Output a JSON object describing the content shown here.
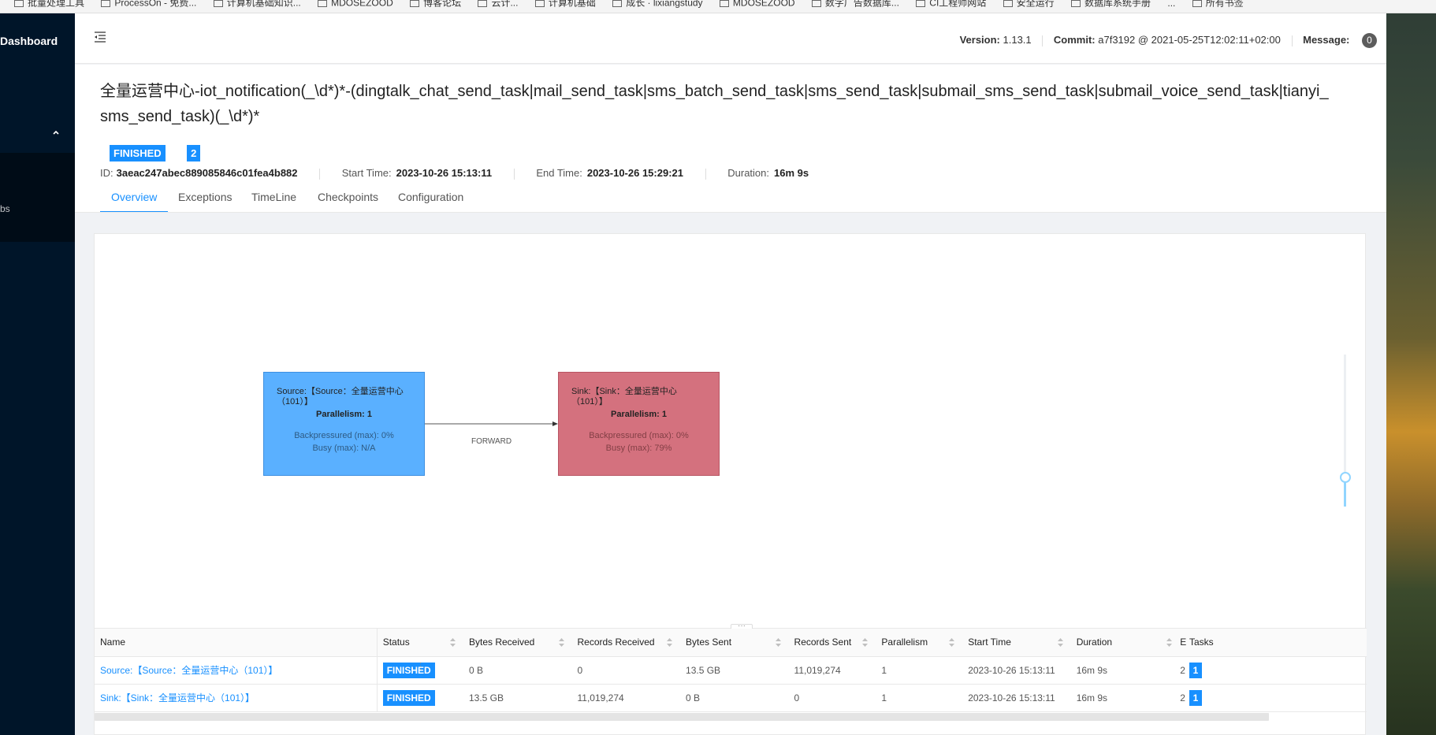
{
  "browser": {
    "bookmarks": [
      "批量处理工具",
      "ProcessOn - 免费...",
      "计算机基础知识...",
      "",
      "MDOSEZOOD",
      "博客论坛",
      "云计...",
      "计算机基础",
      "成长 · lixiangstudy",
      "MDOSEZOOD",
      "",
      "数字广告数据库...",
      "CI工程师网站",
      "安全运行",
      "数据库系统手册",
      "...",
      "所有书签"
    ]
  },
  "sidebar": {
    "brand": "Dashboard",
    "sub_item": "bs"
  },
  "topbar": {
    "version_label": "Version:",
    "version_value": "1.13.1",
    "commit_label": "Commit:",
    "commit_value": "a7f3192 @ 2021-05-25T12:02:11+02:00",
    "message_label": "Message:",
    "message_count": "0"
  },
  "job": {
    "title": "全量运营中心-iot_notification(_\\d*)*-(dingtalk_chat_send_task|mail_send_task|sms_batch_send_task|sms_send_task|submail_sms_send_task|submail_voice_send_task|tianyi_sms_send_task)(_\\d*)*",
    "status": "FINISHED",
    "task_count": "2",
    "id_label": "ID:",
    "id_value": "3aeac247abec889085846c01fea4b882",
    "start_label": "Start Time:",
    "start_value": "2023-10-26 15:13:11",
    "end_label": "End Time:",
    "end_value": "2023-10-26 15:29:21",
    "duration_label": "Duration:",
    "duration_value": "16m 9s"
  },
  "tabs": [
    {
      "label": "Overview"
    },
    {
      "label": "Exceptions"
    },
    {
      "label": "TimeLine"
    },
    {
      "label": "Checkpoints"
    },
    {
      "label": "Configuration"
    }
  ],
  "graph": {
    "source": {
      "name": "Source:【Source：全量运营中心（101）】",
      "parallelism": "Parallelism: 1",
      "backpressured": "Backpressured (max): 0%",
      "busy": "Busy (max): N/A"
    },
    "sink": {
      "name": "Sink:【Sink：全量运营中心（101）】",
      "parallelism": "Parallelism: 1",
      "backpressured": "Backpressured (max): 0%",
      "busy": "Busy (max): 79%"
    },
    "edge_label": "FORWARD",
    "colors": {
      "source": "#5ab0ff",
      "sink": "#d4717e",
      "accent": "#1890ff"
    }
  },
  "table": {
    "columns": [
      "Name",
      "Status",
      "Bytes Received",
      "Records Received",
      "Bytes Sent",
      "Records Sent",
      "Parallelism",
      "Start Time",
      "Duration",
      "E",
      "Tasks"
    ],
    "rows": [
      {
        "name": "Source:【Source：全量运营中心（101）】",
        "status": "FINISHED",
        "bytes_received": "0 B",
        "records_received": "0",
        "bytes_sent": "13.5 GB",
        "records_sent": "11,019,274",
        "parallelism": "1",
        "start_time": "2023-10-26 15:13:11",
        "duration": "16m 9s",
        "end": "2",
        "tasks": "1"
      },
      {
        "name": "Sink:【Sink：全量运营中心（101）】",
        "status": "FINISHED",
        "bytes_received": "13.5 GB",
        "records_received": "11,019,274",
        "bytes_sent": "0 B",
        "records_sent": "0",
        "parallelism": "1",
        "start_time": "2023-10-26 15:13:11",
        "duration": "16m 9s",
        "end": "2",
        "tasks": "1"
      }
    ]
  }
}
